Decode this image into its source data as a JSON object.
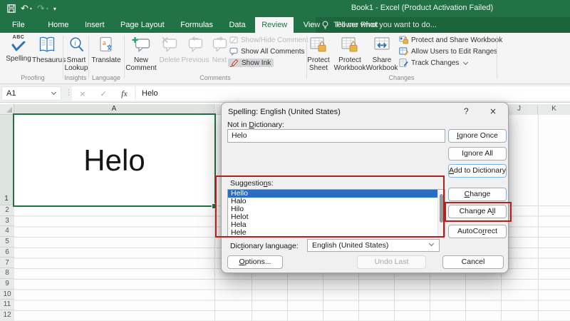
{
  "titlebar": {
    "title": "Book1 - Excel (Product Activation Failed)"
  },
  "tabs": {
    "items": [
      "File",
      "Home",
      "Insert",
      "Page Layout",
      "Formulas",
      "Data",
      "Review",
      "View",
      "Power Pivot"
    ],
    "active": "Review",
    "tell_me": "Tell me what you want to do..."
  },
  "ribbon": {
    "spelling": "Spelling",
    "thesaurus": "Thesaurus",
    "smart_lookup": "Smart Lookup",
    "translate": "Translate",
    "new_comment": "New Comment",
    "delete": "Delete",
    "previous": "Previous",
    "next": "Next",
    "show_hide_comment": "Show/Hide Comment",
    "show_all_comments": "Show All Comments",
    "show_ink": "Show Ink",
    "protect_sheet": "Protect Sheet",
    "protect_workbook": "Protect Workbook",
    "share_workbook": "Share Workbook",
    "protect_share": "Protect and Share Workbook",
    "allow_users": "Allow Users to Edit Ranges",
    "track_changes": "Track Changes",
    "groups": {
      "proofing": "Proofing",
      "insights": "Insights",
      "language": "Language",
      "comments": "Comments",
      "changes": "Changes"
    }
  },
  "formula_bar": {
    "name_box": "A1",
    "formula": "Helo",
    "fx": "fx"
  },
  "grid": {
    "columns": {
      "a": "A",
      "j": "J",
      "k": "K"
    },
    "rows": [
      "1",
      "2",
      "3",
      "4",
      "5",
      "6",
      "7",
      "8",
      "9",
      "10",
      "11",
      "12"
    ],
    "cell_a1": "Helo"
  },
  "dialog": {
    "title": "Spelling: English (United States)",
    "help_glyph": "?",
    "close_glyph": "×",
    "not_in_dictionary": {
      "pre": "Not in ",
      "key": "D",
      "post": "ictionary:"
    },
    "word": "Helo",
    "suggestions_label": {
      "pre": "Suggestio",
      "key": "n",
      "post": "s:"
    },
    "suggestions": [
      "Hello",
      "Halo",
      "Hilo",
      "Helot",
      "Hela",
      "Hele"
    ],
    "selected_suggestion": "Hello",
    "dictionary_language_label": {
      "pre": "Dic",
      "key": "t",
      "post": "ionary language:"
    },
    "dictionary_language": "English (United States)",
    "ignore_once": {
      "pre": "",
      "key": "I",
      "post": "gnore Once"
    },
    "ignore_all": {
      "pre": "I",
      "key": "g",
      "post": "nore All"
    },
    "add_to_dictionary": {
      "pre": "",
      "key": "A",
      "post": "dd to Dictionary"
    },
    "change": {
      "pre": "",
      "key": "C",
      "post": "hange"
    },
    "change_all": {
      "pre": "Change A",
      "key": "l",
      "post": "l"
    },
    "autocorrect": {
      "pre": "AutoCo",
      "key": "r",
      "post": "rect"
    },
    "options": {
      "pre": "",
      "key": "O",
      "post": "ptions..."
    },
    "undo_last": "Undo Last",
    "cancel": "Cancel"
  },
  "colors": {
    "excel_green": "#217346",
    "selection_blue": "#2a6dc3",
    "annotation_red": "#b3211f",
    "lock_amber": "#edb24a",
    "icon_blue": "#2e75b6"
  }
}
